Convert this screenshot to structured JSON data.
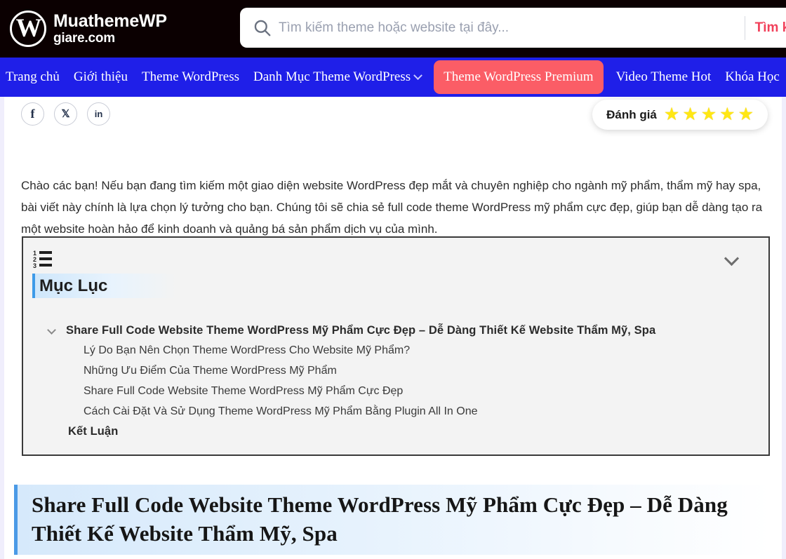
{
  "header": {
    "brand_name": "MuathemeWP",
    "brand_sub": "giare.com",
    "logo_letter": "W",
    "search": {
      "placeholder": "Tìm kiếm theme hoặc website tại đây...",
      "value": "",
      "button_label": "Tìm kiếm",
      "icon": "search-icon"
    }
  },
  "nav": {
    "items": [
      {
        "label": "Trang chủ",
        "has_dropdown": false
      },
      {
        "label": "Giới thiệu",
        "has_dropdown": false
      },
      {
        "label": "Theme WordPress",
        "has_dropdown": false
      },
      {
        "label": "Danh Mục Theme WordPress",
        "has_dropdown": true
      }
    ],
    "cta_label": "Theme WordPress Premium",
    "items_after": [
      {
        "label": "Video Theme Hot",
        "has_dropdown": false
      },
      {
        "label": "Khóa Học",
        "has_dropdown": false
      }
    ],
    "bg_color": "#1f1fe8",
    "cta_color": "#fb5d66"
  },
  "social": {
    "items": [
      {
        "name": "facebook",
        "glyph": "f"
      },
      {
        "name": "x-twitter",
        "glyph": "𝕏"
      },
      {
        "name": "linkedin",
        "glyph": "in"
      }
    ]
  },
  "rating": {
    "label": "Đánh giá",
    "stars": 5,
    "star_glyph": "★",
    "star_color": "#ffe713"
  },
  "article": {
    "intro": "Chào các bạn! Nếu bạn đang tìm kiếm một giao diện website WordPress đẹp mắt và chuyên nghiệp cho ngành mỹ phẩm, thẩm mỹ hay spa, bài viết này chính là lựa chọn lý tưởng cho bạn. Chúng tôi sẽ chia sẻ full code theme WordPress mỹ phẩm cực đẹp, giúp bạn dễ dàng tạo ra một website hoàn hảo để kinh doanh và quảng bá sản phẩm dịch vụ của mình.",
    "heading": "Share Full Code Website Theme WordPress Mỹ Phẩm Cực Đẹp – Dễ Dàng Thiết Kế Website Thẩm Mỹ, Spa"
  },
  "toc": {
    "title": "Mục Lục",
    "icon": "numbered-list-icon",
    "toggle_icon": "chevron-down-icon",
    "entries": [
      {
        "level": 1,
        "label": "Share Full Code Website Theme WordPress Mỹ Phẩm Cực Đẹp – Dễ Dàng Thiết Kế Website Thẩm Mỹ, Spa",
        "has_chevron": true
      },
      {
        "level": 2,
        "label": "Lý Do Bạn Nên Chọn Theme WordPress Cho Website Mỹ Phẩm?"
      },
      {
        "level": 2,
        "label": "Những Ưu Điểm Của Theme WordPress Mỹ Phẩm"
      },
      {
        "level": 2,
        "label": "Share Full Code Website Theme WordPress Mỹ Phẩm Cực Đẹp"
      },
      {
        "level": 2,
        "label": "Cách Cài Đặt Và Sử Dụng Theme WordPress Mỹ Phẩm Bằng Plugin All In One"
      },
      {
        "level": 1,
        "label": "Kết Luận",
        "has_chevron": false
      }
    ]
  }
}
